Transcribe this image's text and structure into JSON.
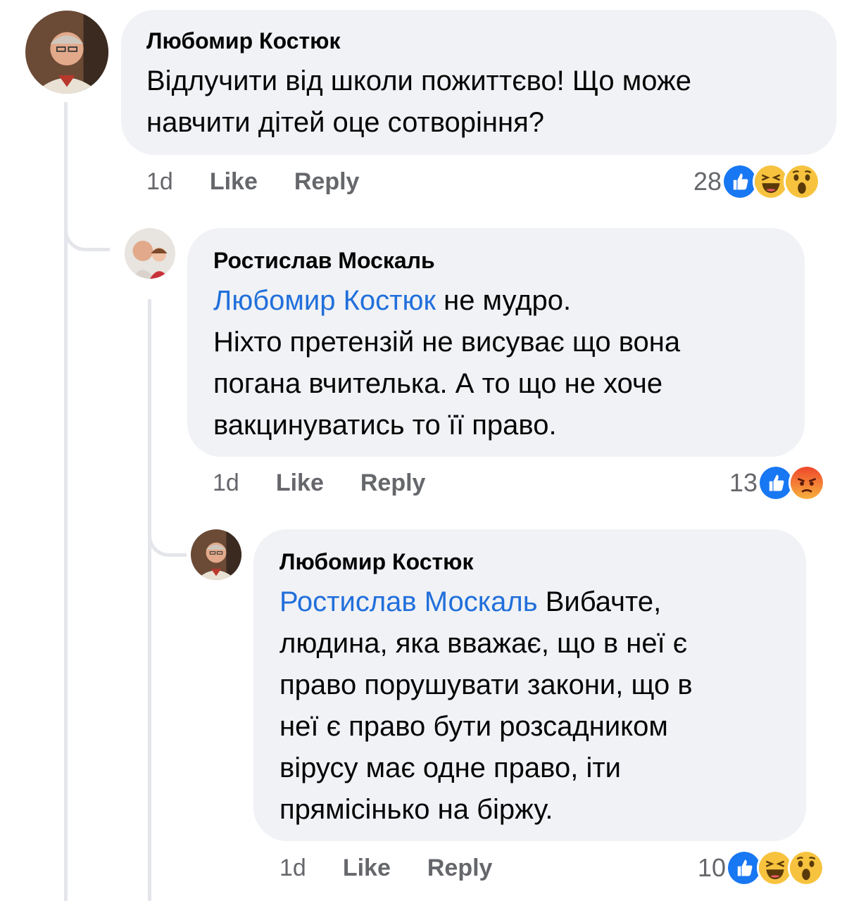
{
  "comments": [
    {
      "author": "Любомир Костюк",
      "text_line1": "Відлучити від школи пожиттєво! Що може",
      "text_line2": "навчити дітей оце сотворіння?",
      "time": "1d",
      "like": "Like",
      "reply": "Reply",
      "reaction_count": "28",
      "reactions": [
        "like-icon",
        "haha-icon",
        "wow-icon"
      ]
    },
    {
      "author": "Ростислав Москаль",
      "mention": "Любомир Костюк",
      "text_line1_rest": " не мудро.",
      "text_line2": "Ніхто претензій не висуває що вона",
      "text_line3": "погана вчителька. А то що не хоче",
      "text_line4": "вакцинуватись то її право.",
      "time": "1d",
      "like": "Like",
      "reply": "Reply",
      "reaction_count": "13",
      "reactions": [
        "like-icon",
        "angry-icon"
      ]
    },
    {
      "author": "Любомир Костюк",
      "mention": "Ростислав Москаль",
      "text_line1_rest": " Вибачте,",
      "text_line2": "людина, яка вважає, що в неї є",
      "text_line3": "право порушувати закони, що в",
      "text_line4": "неї є право бути розсадником",
      "text_line5": "вірусу має одне право, іти",
      "text_line6": "прямісінько на біржу.",
      "time": "1d",
      "like": "Like",
      "reply": "Reply",
      "reaction_count": "10",
      "reactions": [
        "like-icon",
        "haha-icon",
        "wow-icon"
      ]
    }
  ],
  "colors": {
    "bubble": "#f0f2f5",
    "mention": "#216fdb",
    "meta": "#65676b",
    "like_blue": "#1877f2",
    "angry": "#f0472b",
    "emoji_yellow": "#f7c33e"
  }
}
